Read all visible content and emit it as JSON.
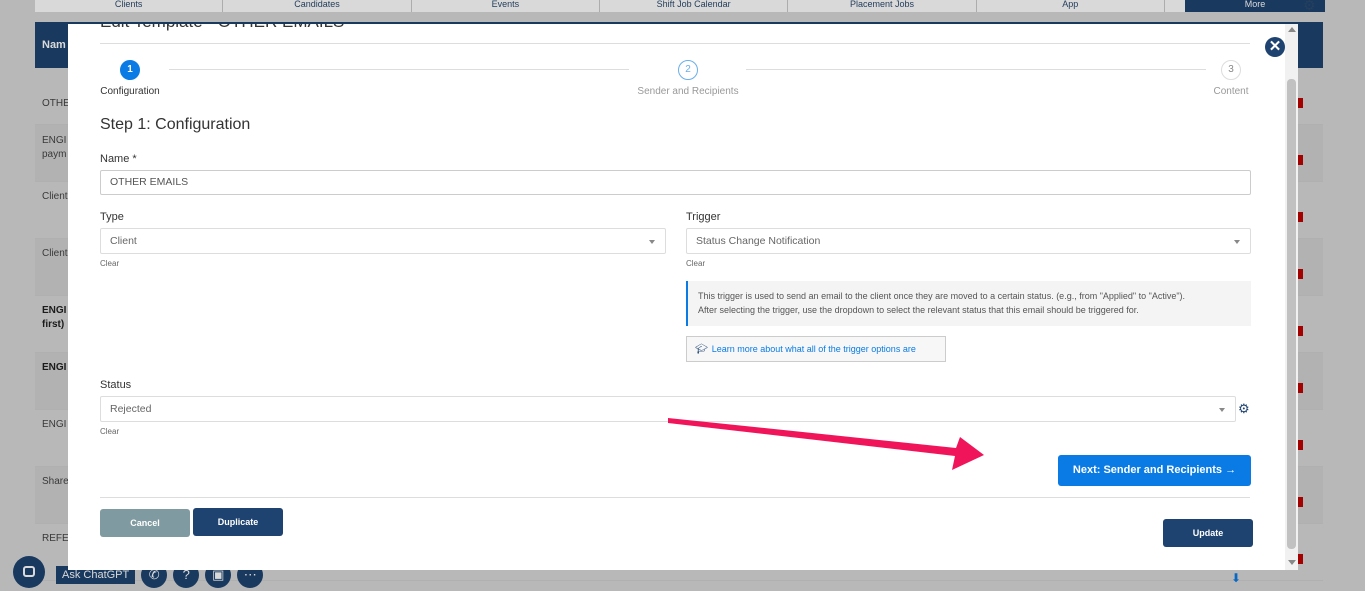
{
  "bg_nav": [
    "Clients",
    "Candidates",
    "Events",
    "Shift Job Calendar",
    "Placement Jobs",
    "App"
  ],
  "bg_nav_more": "More",
  "bg_header_name": "Nam",
  "bg_rows": [
    {
      "text": "OTHE",
      "style": "normal"
    },
    {
      "text": "ENGI\npaym",
      "style": "alt"
    },
    {
      "text": "Client",
      "style": "normal"
    },
    {
      "text": "Client",
      "style": "alt"
    },
    {
      "text": "ENGI\nfirst)",
      "style": "bold"
    },
    {
      "text": "ENGI",
      "style": "bold-alt"
    },
    {
      "text": "ENGI",
      "style": "normal"
    },
    {
      "text": "Share",
      "style": "alt"
    },
    {
      "text": "REFE",
      "style": "normal"
    }
  ],
  "bg_chat_label": "Ask ChatGPT",
  "modal": {
    "title": "Edit Template - OTHER EMAILS",
    "steps": [
      {
        "number": "1",
        "label": "Configuration"
      },
      {
        "number": "2",
        "label": "Sender and Recipients"
      },
      {
        "number": "3",
        "label": "Content"
      }
    ],
    "step_heading": "Step 1: Configuration",
    "name_label": "Name *",
    "name_value": "OTHER EMAILS",
    "type_label": "Type",
    "type_value": "Client",
    "trigger_label": "Trigger",
    "trigger_value": "Status Change Notification",
    "clear_label": "Clear",
    "info_line1": "This trigger is used to send an email to the client once they are moved to a certain status. (e.g., from \"Applied\" to \"Active\").",
    "info_line2": "After selecting the trigger, use the dropdown to select the relevant status that this email should be triggered for.",
    "learn_more": "Learn more about what all of the trigger options are",
    "status_label": "Status",
    "status_value": "Rejected",
    "next_button": "Next: Sender and Recipients →",
    "cancel_button": "Cancel",
    "duplicate_button": "Duplicate",
    "update_button": "Update"
  },
  "colors": {
    "accent": "#0a7be5",
    "navy": "#1e4370",
    "annotation_arrow": "#f0145a"
  }
}
